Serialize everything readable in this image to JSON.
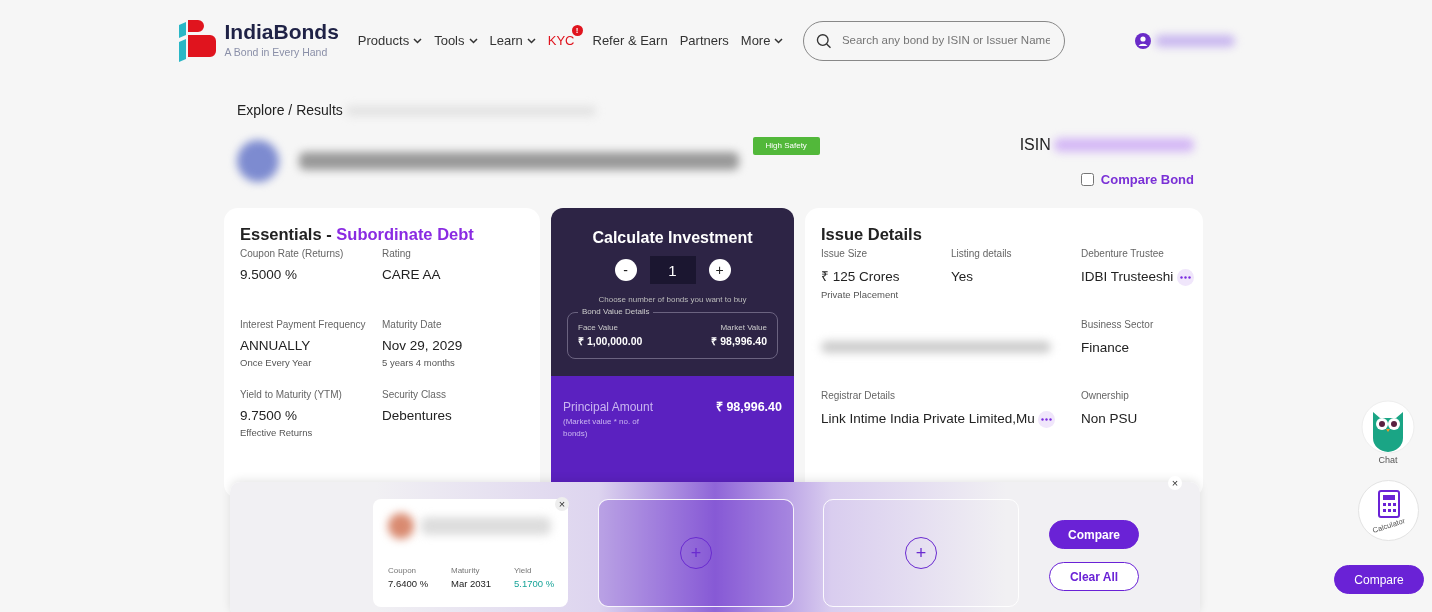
{
  "header": {
    "logo": {
      "name": "IndiaBonds",
      "tagline": "A Bond in Every Hand"
    },
    "nav": [
      {
        "label": "Products",
        "kind": "dropdown"
      },
      {
        "label": "Tools",
        "kind": "dropdown"
      },
      {
        "label": "Learn",
        "kind": "dropdown"
      },
      {
        "label": "KYC",
        "kind": "alert",
        "badge": "!"
      },
      {
        "label": "Refer & Earn",
        "kind": "link"
      },
      {
        "label": "Partners",
        "kind": "link"
      },
      {
        "label": "More",
        "kind": "dropdown"
      }
    ],
    "search": {
      "placeholder": "Search any bond by ISIN or Issuer Name"
    }
  },
  "breadcrumb": "Explore / Results",
  "bond": {
    "safety_badge": "High Safety",
    "isin_label": "ISIN",
    "compare_checkbox": {
      "label": "Compare Bond",
      "checked": false
    }
  },
  "essentials": {
    "title": "Essentials - ",
    "subtitle": "Subordinate Debt",
    "fields": [
      {
        "label": "Coupon Rate (Returns)",
        "value": "9.5000 %"
      },
      {
        "label": "Rating",
        "value": "CARE  AA"
      },
      {
        "label": "Interest Payment Frequency",
        "value": "ANNUALLY",
        "note": "Once Every Year"
      },
      {
        "label": "Maturity Date",
        "value": "Nov 29, 2029",
        "note": "5 years 4 months"
      },
      {
        "label": "Yield to Maturity (YTM)",
        "value": "9.7500 %",
        "note": "Effective Returns"
      },
      {
        "label": "Security Class",
        "value": "Debentures"
      }
    ]
  },
  "calculator": {
    "title": "Calculate Investment",
    "minus": "-",
    "quantity": "1",
    "plus": "+",
    "hint": "Choose number of bonds you want to buy",
    "legend": "Bond Value Details",
    "values": [
      {
        "label": "Face Value",
        "value": "₹ 1,00,000.00"
      },
      {
        "label": "Market Value",
        "value": "₹ 98,996.40"
      }
    ],
    "principal": {
      "label": "Principal Amount",
      "note": "(Market value * no. of bonds)",
      "amount": "₹ 98,996.40"
    }
  },
  "issue_details": {
    "title": "Issue Details",
    "fields": [
      {
        "kind": "plain",
        "label": "Issue Size",
        "value": "₹ 125 Crores",
        "note": "Private Placement",
        "more": false
      },
      {
        "kind": "plain",
        "label": "Listing details",
        "value": "Yes",
        "more": false
      },
      {
        "kind": "plain",
        "label": "Debenture Trustee",
        "value": "IDBI Trusteeshi",
        "more": true
      },
      {
        "kind": "blurred"
      },
      {
        "kind": "plain",
        "label": "Business Sector",
        "value": "Finance",
        "more": false
      },
      {
        "kind": "plain",
        "label": "Registrar Details",
        "value": "Link Intime India Private Limited,Mu",
        "more": true,
        "wide": true
      },
      {
        "kind": "plain",
        "label": "Ownership",
        "value": "Non PSU",
        "more": false
      }
    ]
  },
  "compare_tray": {
    "close": "×",
    "bond_card": {
      "close": "×",
      "stats": [
        {
          "label": "Coupon",
          "value": "7.6400 %",
          "highlighted": false
        },
        {
          "label": "Maturity",
          "value": "Mar 2031",
          "highlighted": false
        },
        {
          "label": "Yield",
          "value": "5.1700 %",
          "highlighted": true
        }
      ]
    },
    "empty_slots": [
      {
        "add": "+",
        "highlighted": true
      },
      {
        "add": "+",
        "highlighted": false
      }
    ],
    "buttons": [
      {
        "label": "Compare",
        "kind": "primary"
      },
      {
        "label": "Clear All",
        "kind": "outline"
      }
    ]
  },
  "floating": {
    "chat_label": "Chat",
    "calculator_label": "Calculator",
    "compare_button": "Compare"
  }
}
